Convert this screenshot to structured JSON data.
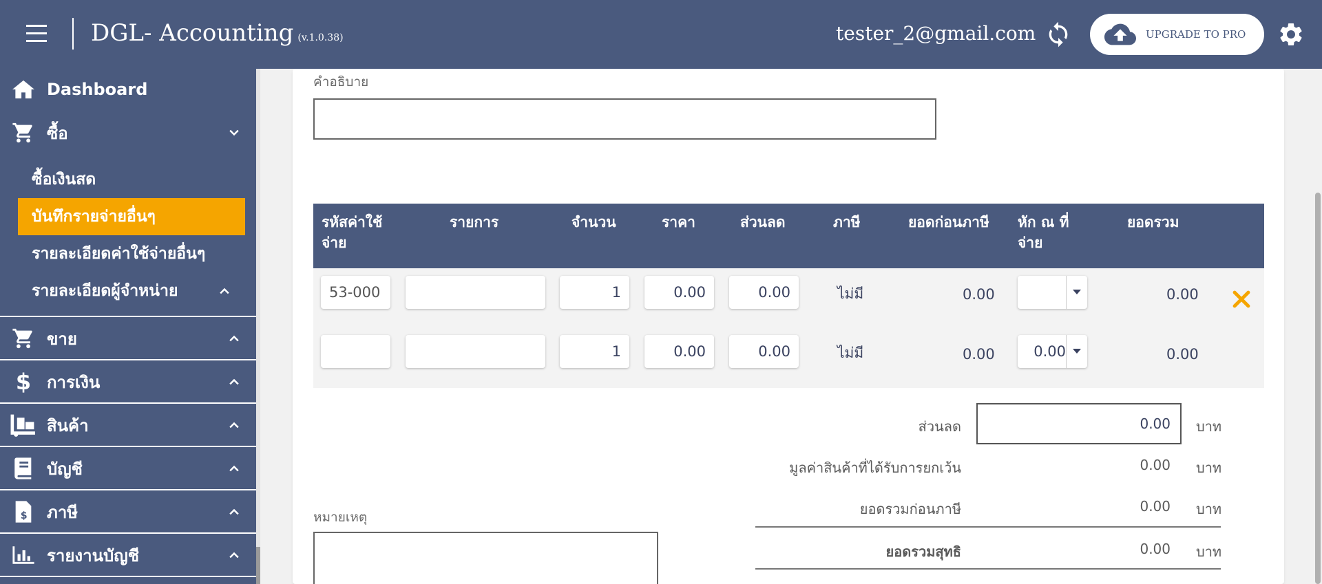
{
  "header": {
    "app_title": "DGL- Accounting",
    "version": "(v.1.0.38)",
    "user_email": "tester_2@gmail.com",
    "upgrade_label": "UPGRADE TO PRO"
  },
  "sidebar": {
    "dashboard": "Dashboard",
    "buy": "ซื้อ",
    "buy_items": [
      "ซื้อเงินสด",
      "บันทึกรายจ่ายอื่นๆ",
      "รายละเอียดค่าใช้จ่ายอื่นๆ",
      "รายละเอียดผู้จำหน่าย"
    ],
    "active_item": "บันทึกรายจ่ายอื่นๆ",
    "sell": "ขาย",
    "finance": "การเงิน",
    "products": "สินค้า",
    "accounts": "บัญชี",
    "tax": "ภาษี",
    "reports": "รายงานบัญชี"
  },
  "form": {
    "description_label": "คำอธิบาย",
    "description_value": "",
    "note_label": "หมายเหตุ"
  },
  "table": {
    "headers": {
      "code": [
        "รหัสค่าใช้",
        "จ่าย"
      ],
      "item": "รายการ",
      "qty": "จำนวน",
      "price": "ราคา",
      "discount": "ส่วนลด",
      "tax": "ภาษี",
      "pretax": "ยอดก่อนภาษี",
      "wht": [
        "หัก ณ ที่",
        "จ่าย"
      ],
      "total": "ยอดรวม"
    },
    "rows": [
      {
        "code": "53-000",
        "item": "",
        "qty": "1",
        "price": "0.00",
        "discount": "0.00",
        "tax": "ไม่มี",
        "pretax": "0.00",
        "wht": "",
        "total": "0.00"
      },
      {
        "code": "",
        "item": "",
        "qty": "1",
        "price": "0.00",
        "discount": "0.00",
        "tax": "ไม่มี",
        "pretax": "0.00",
        "wht": "0.00",
        "total": "0.00"
      }
    ]
  },
  "summary": {
    "discount_label": "ส่วนลด",
    "discount_value": "0.00",
    "exempt_label": "มูลค่าสินค้าที่ได้รับการยกเว้น",
    "exempt_value": "0.00",
    "pretax_label": "ยอดรวมก่อนภาษี",
    "pretax_value": "0.00",
    "net_label": "ยอดรวมสุทธิ",
    "net_value": "0.00",
    "unit": "บาท"
  },
  "colors": {
    "primary": "#4a5a7e",
    "active": "#f5a500",
    "delete": "#f5a500"
  }
}
